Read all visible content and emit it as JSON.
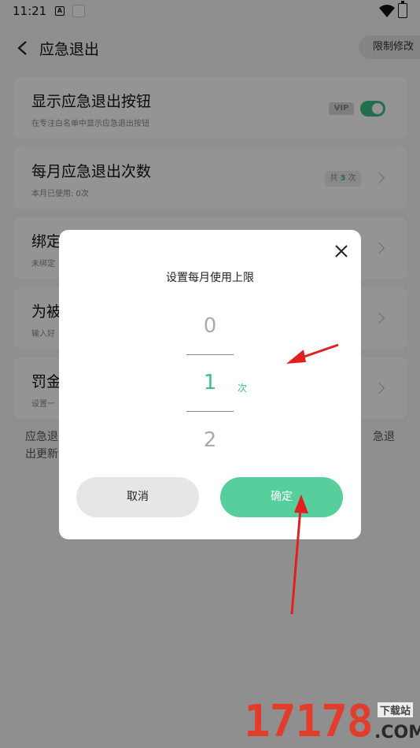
{
  "status_bar": {
    "time": "11:21"
  },
  "header": {
    "title": "应急退出",
    "limit_button": "限制修改"
  },
  "cards": [
    {
      "label": "显示应急退出按钮",
      "sub": "在专注白名单中显示应急退出按钮",
      "vip": "VIP"
    },
    {
      "label": "每月应急退出次数",
      "sub": "本月已使用: 0次",
      "badge_prefix": "共",
      "badge_count": "3",
      "badge_suffix": "次"
    },
    {
      "label": "绑定",
      "sub": "未绑定"
    },
    {
      "label": "为被",
      "sub": "输入好"
    },
    {
      "label": "罚金",
      "sub": "设置一"
    }
  ],
  "note": {
    "line1_start": "应急退",
    "line1_end": "急退",
    "line2": "出更新"
  },
  "dialog": {
    "title": "设置每月使用上限",
    "options": [
      "0",
      "1",
      "2"
    ],
    "selected": "1",
    "unit": "次",
    "cancel_label": "取消",
    "ok_label": "确定"
  },
  "watermark": {
    "digits": "17178",
    "site": "下载站",
    "domain": ".COM"
  },
  "colors": {
    "accent": "#57cf9c",
    "arrow": "#e02020"
  }
}
